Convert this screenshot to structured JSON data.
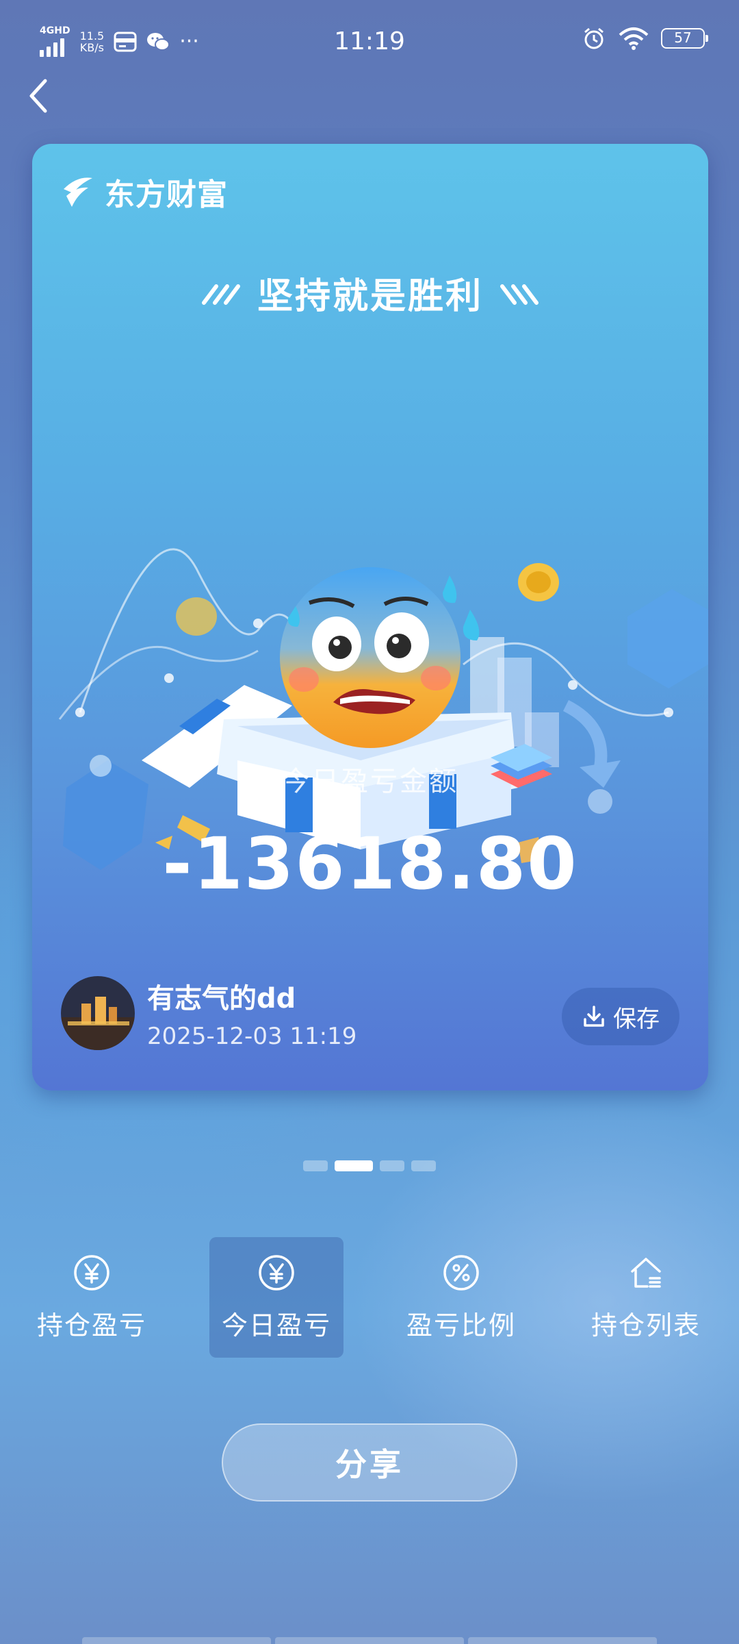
{
  "status_bar": {
    "network": "4GHD",
    "speed_value": "11.5",
    "speed_unit": "KB/s",
    "more": "···",
    "time": "11:19",
    "battery": "57"
  },
  "card": {
    "brand": "东方财富",
    "slogan": "坚持就是胜利",
    "pnl_label": "今日盈亏金额",
    "pnl_value": "-13618.80",
    "user_name": "有志气的dd",
    "timestamp": "2025-12-03 11:19",
    "save_label": "保存"
  },
  "pager": {
    "count": 4,
    "active_index": 1
  },
  "tabs": [
    {
      "label": "持仓盈亏",
      "icon": "yen-circle-icon"
    },
    {
      "label": "今日盈亏",
      "icon": "yen-circle-icon",
      "active": true
    },
    {
      "label": "盈亏比例",
      "icon": "percent-circle-icon"
    },
    {
      "label": "持仓列表",
      "icon": "home-list-icon"
    }
  ],
  "share_label": "分享"
}
